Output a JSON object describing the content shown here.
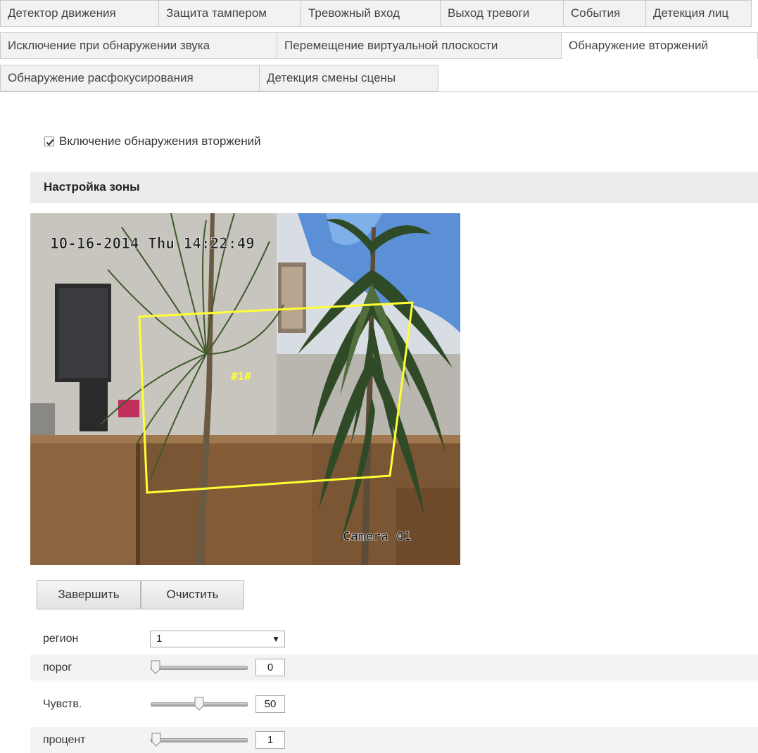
{
  "tabs": {
    "row1": [
      "Детектор движения",
      "Защита тампером",
      "Тревожный вход",
      "Выход тревоги",
      "События",
      "Детекция лиц"
    ],
    "row2": [
      "Исключение при обнаружении звука",
      "Перемещение виртуальной плоскости",
      "Обнаружение вторжений"
    ],
    "row3": [
      "Обнаружение расфокусирования",
      "Детекция смены сцены"
    ],
    "active": "Обнаружение вторжений"
  },
  "enable": {
    "label": "Включение обнаружения вторжений",
    "checked": true
  },
  "zone_section": {
    "title": "Настройка зоны"
  },
  "video": {
    "timestamp": "10-16-2014 Thu 14:22:49",
    "region_tag": "#1#",
    "camera_name": "Camera 01",
    "region_outline_color": "#ffff33"
  },
  "buttons": {
    "finish": "Завершить",
    "clear": "Очистить"
  },
  "params": {
    "region": {
      "label": "регион",
      "value": "1"
    },
    "threshold": {
      "label": "порог",
      "value": "0",
      "level": 0
    },
    "sensitivity": {
      "label": "Чувств.",
      "value": "50",
      "level": 0.5
    },
    "percent": {
      "label": "процент",
      "value": "1",
      "level": 0.01
    }
  }
}
